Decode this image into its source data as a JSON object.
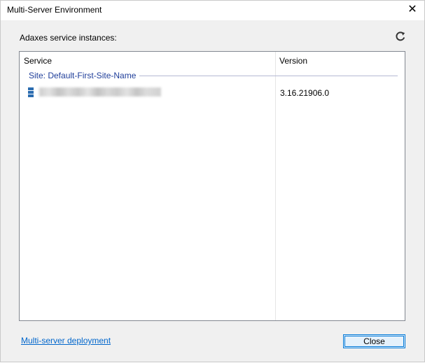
{
  "window": {
    "title": "Multi-Server Environment",
    "close_glyph": "✕"
  },
  "section": {
    "label": "Adaxes service instances:",
    "refresh_icon": "refresh-icon"
  },
  "table": {
    "columns": [
      "Service",
      "Version"
    ],
    "groups": [
      {
        "label": "Site: Default-First-Site-Name",
        "rows": [
          {
            "icon": "server-icon",
            "service": "",
            "version": "3.16.21906.0"
          }
        ]
      }
    ]
  },
  "footer": {
    "link_label": "Multi-server deployment",
    "close_label": "Close"
  },
  "colors": {
    "accent": "#0078d7",
    "group_text": "#1f3e9a",
    "link": "#0066cc",
    "server_icon": "#2b6cb0"
  }
}
